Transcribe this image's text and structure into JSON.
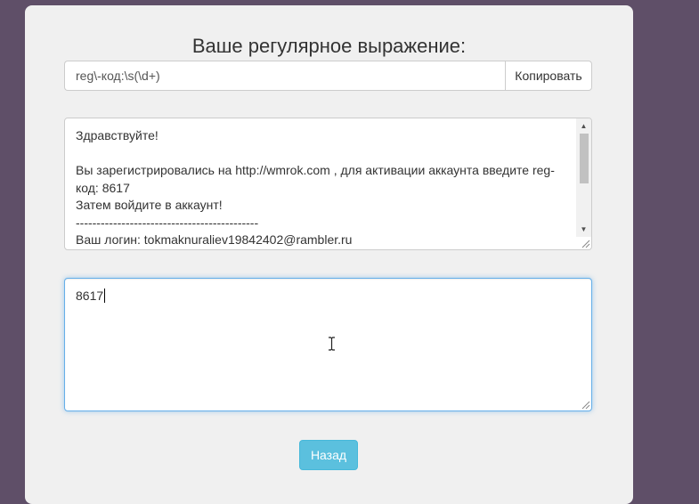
{
  "page": {
    "title": "Ваше регулярное выражение:"
  },
  "regex": {
    "value": "reg\\-код:\\s(\\d+)",
    "copy_label": "Копировать"
  },
  "message": {
    "lines": [
      "Здравствуйте!",
      "",
      "Вы зарегистрировались на http://wmrok.com , для активации аккаунта введите reg-",
      "код: 8617",
      "Затем войдите в аккаунт!",
      "--------------------------------------------",
      "Ваш логин: tokmaknuraliev19842402@rambler.ru"
    ]
  },
  "result": {
    "value": "8617"
  },
  "actions": {
    "back_label": "Назад"
  },
  "colors": {
    "background": "#5f4f68",
    "card": "#f0f0f0",
    "info_button": "#5bc0de",
    "focus_border": "#66afe9"
  },
  "icons": {
    "scroll_up": "triangle-up-icon",
    "scroll_down": "triangle-down-icon",
    "resize": "resize-grip-icon",
    "cursor": "text-cursor-icon"
  }
}
